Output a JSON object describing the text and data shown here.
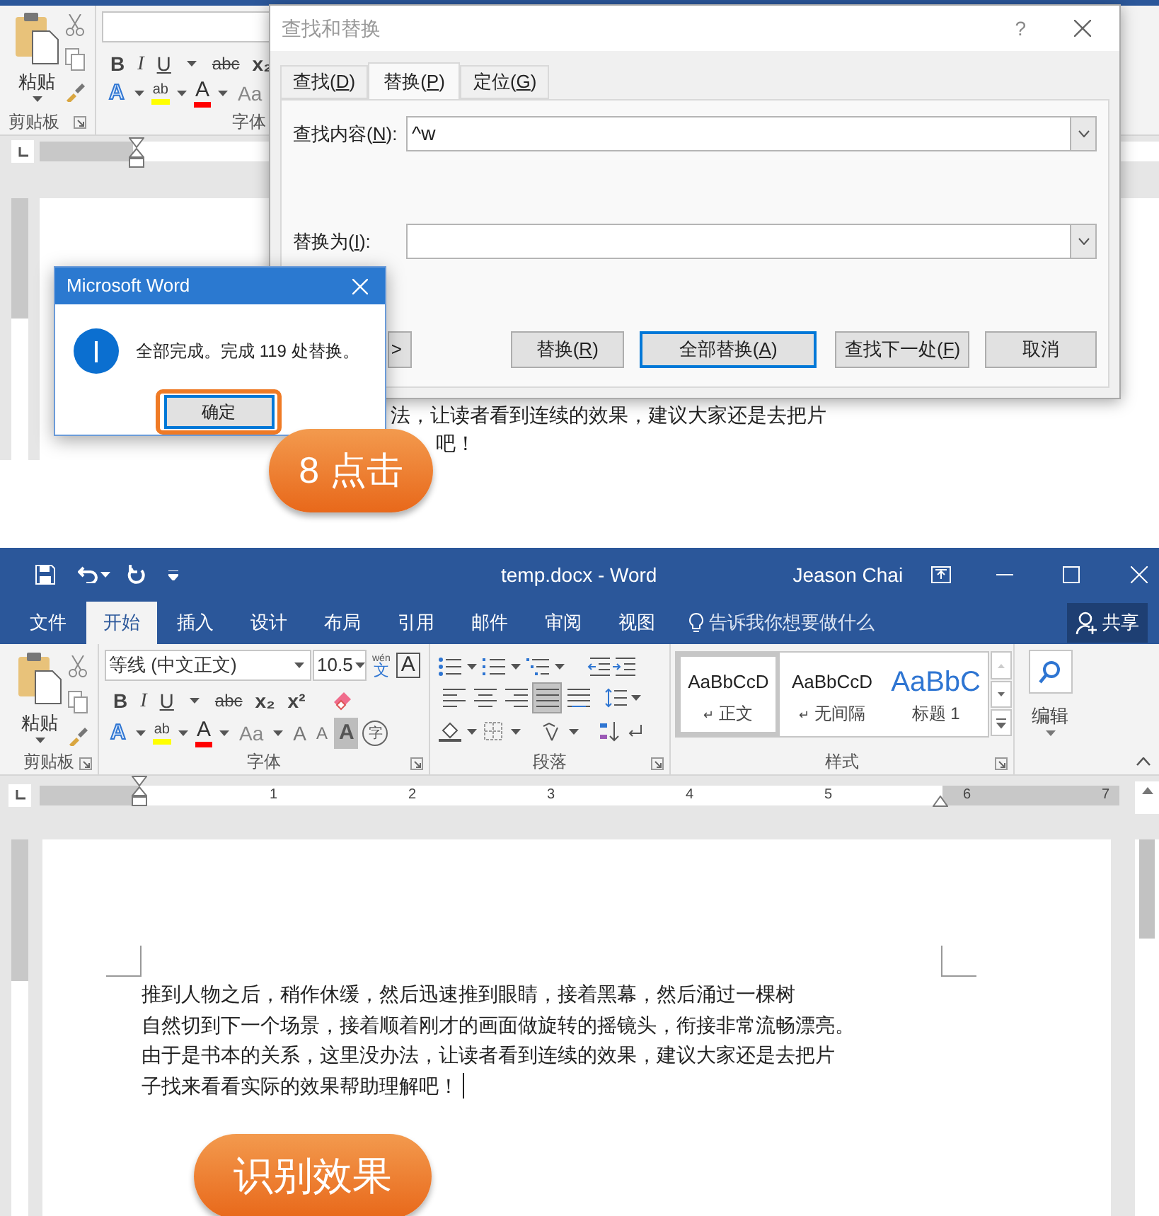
{
  "top_screenshot": {
    "ribbon": {
      "paste_label": "粘贴",
      "clipboard_label": "剪贴板",
      "font_format_buttons": [
        "B",
        "I",
        "U",
        "abc",
        "x₂"
      ],
      "font_color_row": [
        {
          "kind": "text-effect",
          "glyph": "A"
        },
        {
          "kind": "highlight",
          "glyph": "ab"
        },
        {
          "kind": "font-color",
          "glyph": "A"
        },
        {
          "kind": "case",
          "glyph": "Aa"
        }
      ],
      "font_label": "字体"
    },
    "document_fragments": [
      "法，让读者看到连续的效果，建议大家还是去把片",
      "吧！"
    ],
    "find_replace_dialog": {
      "title": "查找和替换",
      "help": "?",
      "tabs": [
        {
          "label": "查找(D)",
          "selected": false
        },
        {
          "label": "替换(P)",
          "selected": true
        },
        {
          "label": "定位(G)",
          "selected": false
        }
      ],
      "find_label": "查找内容(N):",
      "find_value": "^w",
      "replace_label": "替换为(I):",
      "buttons": [
        {
          "label": ">",
          "focused": false
        },
        {
          "label": "替换(R)",
          "focused": false
        },
        {
          "label": "全部替换(A)",
          "focused": true
        },
        {
          "label": "查找下一处(F)",
          "focused": false
        },
        {
          "label": "取消",
          "focused": false
        }
      ]
    },
    "message_box": {
      "title": "Microsoft Word",
      "message": "全部完成。完成 119 处替换。",
      "button": "确定",
      "highlighted": true
    },
    "callout": "8 点击"
  },
  "bottom_screenshot": {
    "title": "temp.docx - Word",
    "user": "Jeason Chai",
    "tabs": [
      {
        "label": "文件",
        "selected": false
      },
      {
        "label": "开始",
        "selected": true
      },
      {
        "label": "插入",
        "selected": false
      },
      {
        "label": "设计",
        "selected": false
      },
      {
        "label": "布局",
        "selected": false
      },
      {
        "label": "引用",
        "selected": false
      },
      {
        "label": "邮件",
        "selected": false
      },
      {
        "label": "审阅",
        "selected": false
      },
      {
        "label": "视图",
        "selected": false
      }
    ],
    "tell_me": "告诉我你想要做什么",
    "share": "共享",
    "paste_label": "粘贴",
    "font_name": "等线 (中文正文)",
    "font_size": "10.5",
    "phonetic": {
      "ruby": "wén",
      "base": "文"
    },
    "char_border": "A",
    "font_format_buttons": [
      "B",
      "I",
      "U",
      "abc",
      "x₂",
      "x²"
    ],
    "font_color_row": [
      {
        "kind": "text-effect",
        "glyph": "A"
      },
      {
        "kind": "highlight",
        "glyph": "ab"
      },
      {
        "kind": "font-color",
        "glyph": "A"
      },
      {
        "kind": "case",
        "glyph": "Aa"
      },
      {
        "kind": "grow",
        "glyph": "A"
      },
      {
        "kind": "shrink",
        "glyph": "A"
      },
      {
        "kind": "shading",
        "glyph": "A"
      },
      {
        "kind": "enclose",
        "glyph": "字"
      }
    ],
    "align_buttons": [
      {
        "selected": false
      },
      {
        "selected": false
      },
      {
        "selected": false
      },
      {
        "selected": true
      },
      {
        "selected": false
      }
    ],
    "styles": [
      {
        "preview": "AaBbCcD",
        "mark": "↵",
        "name": "正文",
        "kind": "body",
        "selected": true
      },
      {
        "preview": "AaBbCcD",
        "mark": "↵",
        "name": "无间隔",
        "kind": "body",
        "selected": false
      },
      {
        "preview": "AaBbC",
        "name": "标题 1",
        "kind": "heading",
        "selected": false
      }
    ],
    "group_labels": {
      "clipboard": "剪贴板",
      "font": "字体",
      "paragraph": "段落",
      "styles": "样式"
    },
    "edit_label": "编辑",
    "ruler_numbers": [
      "1",
      "2",
      "3",
      "4",
      "5",
      "6",
      "7"
    ],
    "document_lines": [
      "推到人物之后，稍作休缓，然后迅速推到眼睛，接着黑幕，然后涌过一棵树",
      "自然切到下一个场景，接着顺着刚才的画面做旋转的摇镜头，衔接非常流畅漂亮。",
      "由于是书本的关系，这里没办法，让读者看到连续的效果，建议大家还是去把片",
      "子找来看看实际的效果帮助理解吧！"
    ],
    "callout": "识别效果"
  }
}
